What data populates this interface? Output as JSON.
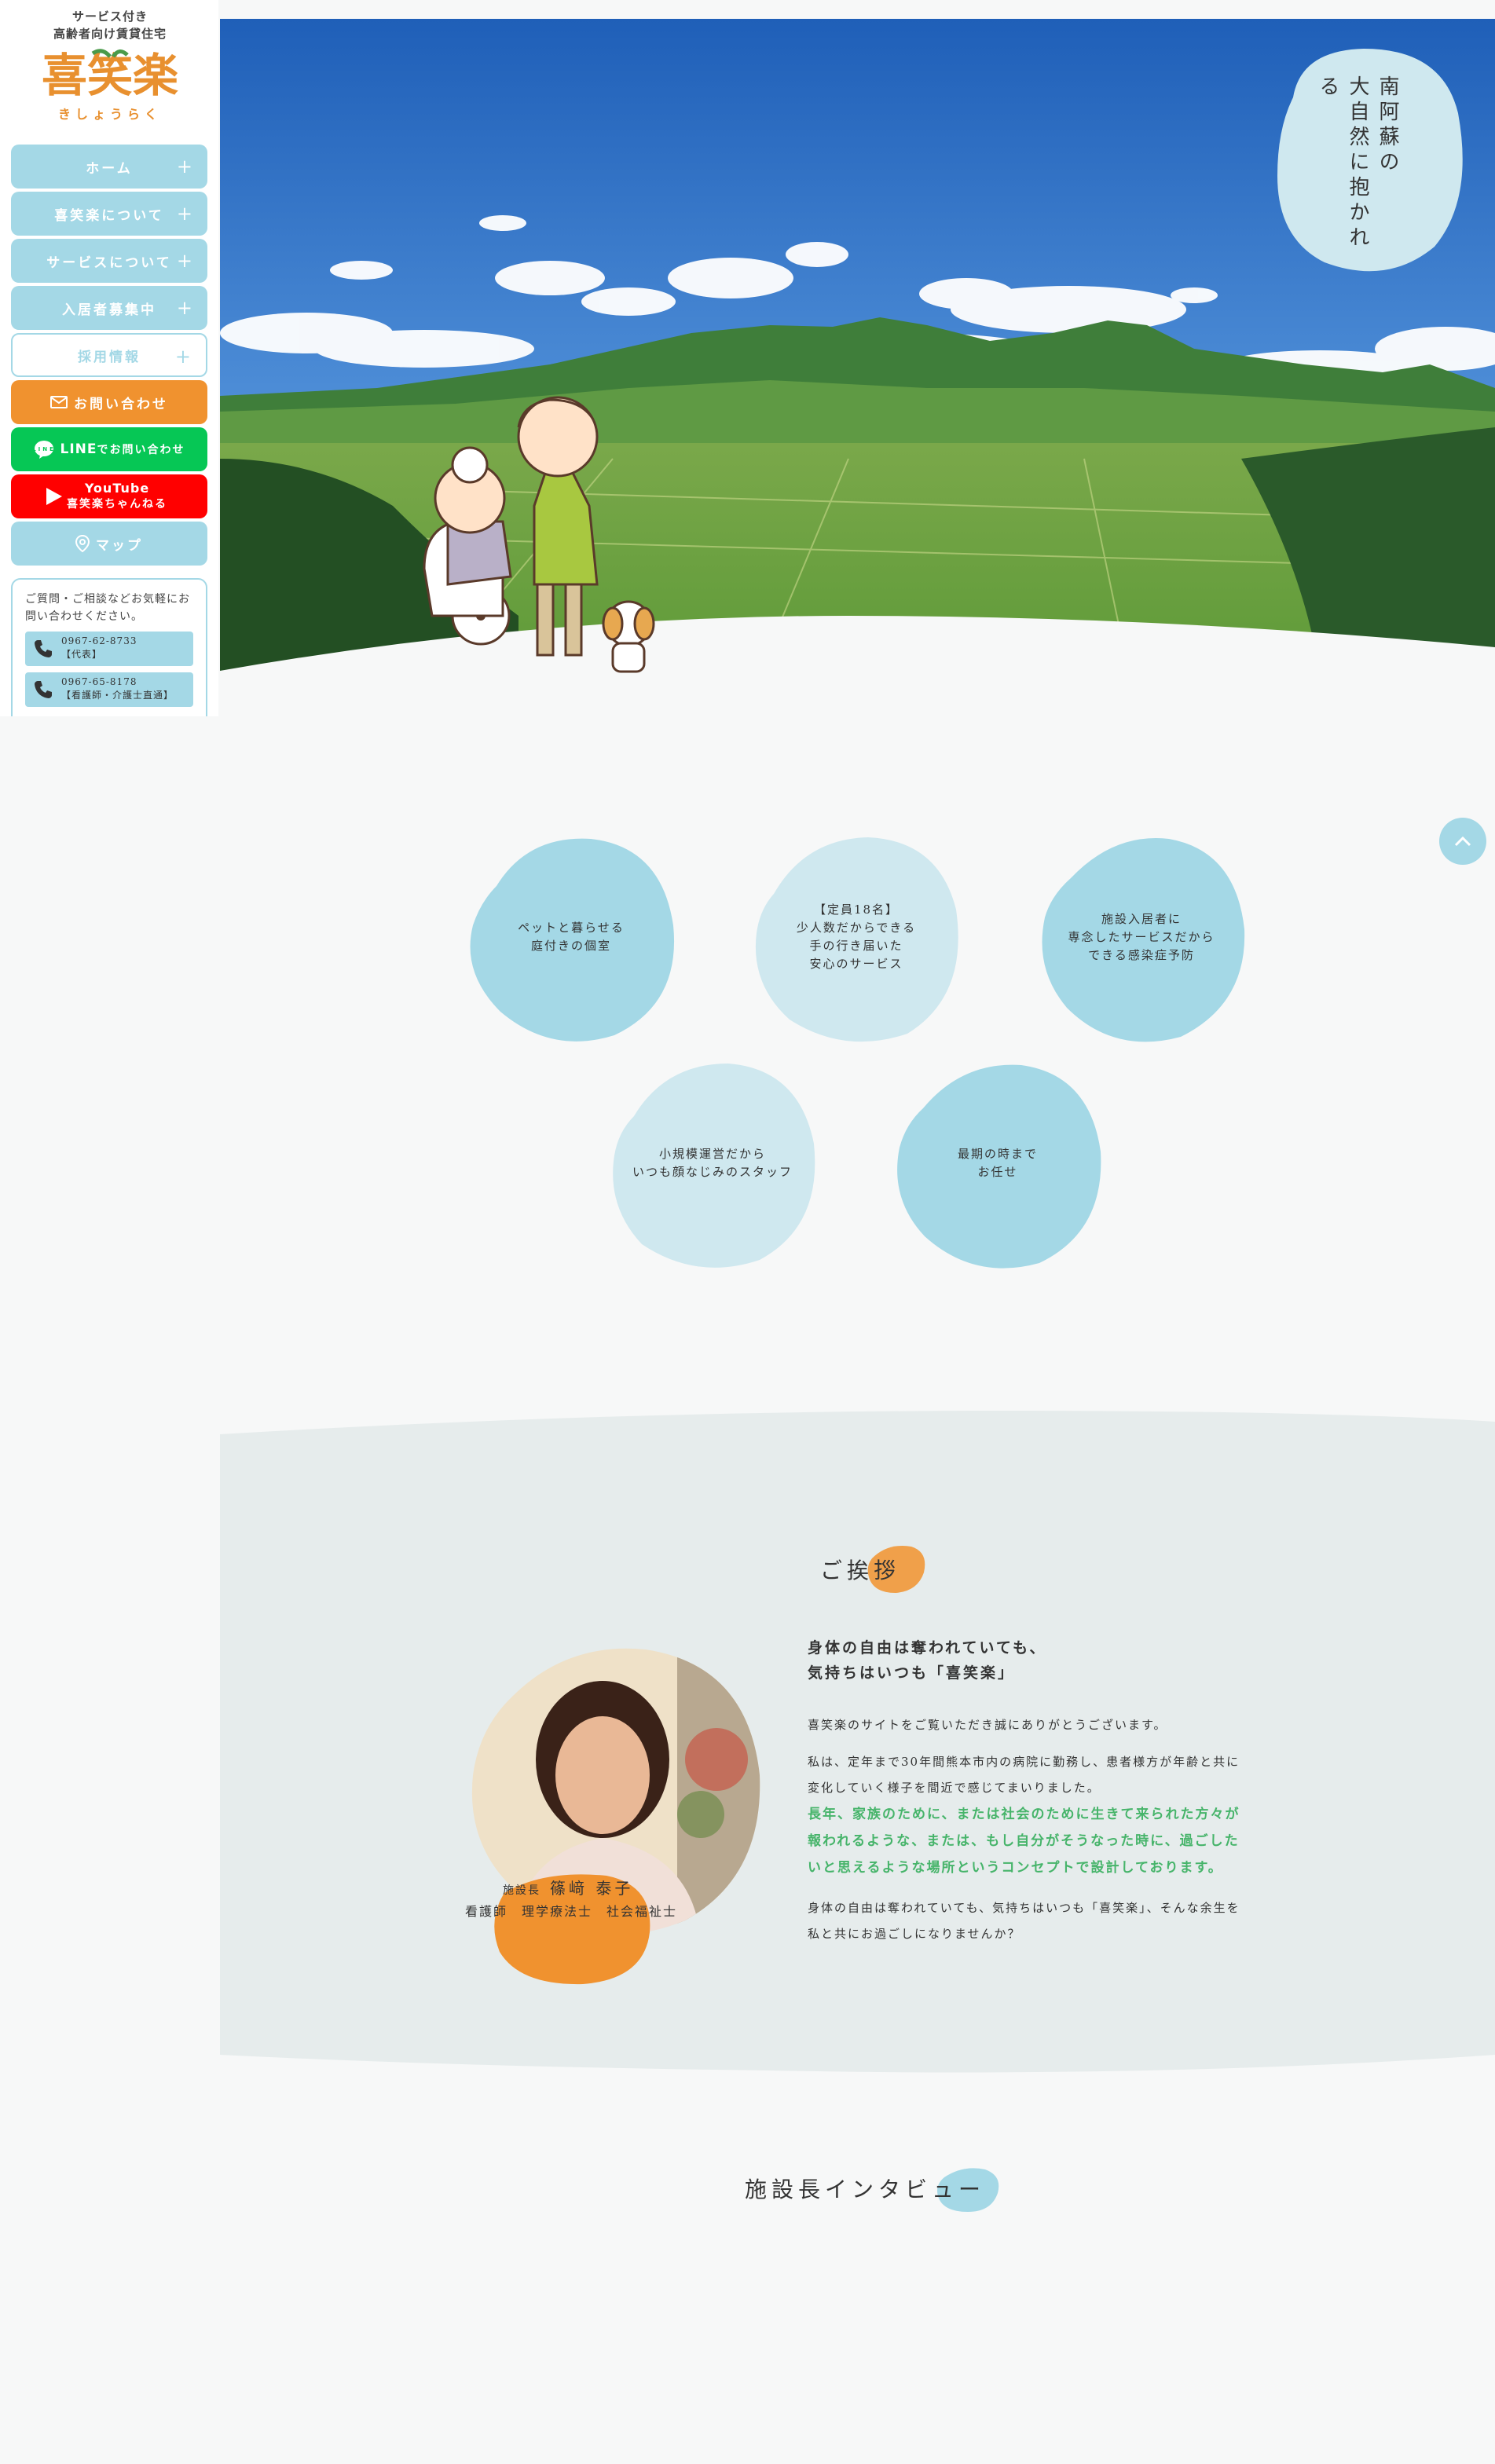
{
  "logo": {
    "line1": "サービス付き",
    "line2": "高齢者向け賃貸住宅",
    "mark": "喜笑楽",
    "kana": "きしょうらく"
  },
  "nav": {
    "home": "ホーム",
    "about": "喜笑楽について",
    "service": "サービスについて",
    "residents": "入居者募集中",
    "recruit": "採用情報",
    "contact": "お問い合わせ",
    "line_bold": "LINE",
    "line_rest": "でお問い合わせ",
    "youtube_title": "YouTube",
    "youtube_channel": "喜笑楽ちゃんねる",
    "map": "マップ",
    "plus": "+"
  },
  "contact_box": {
    "intro": "ご質問・ご相談などお気軽にお問い合わせください。",
    "tel1_number": "0967-62-8733",
    "tel1_label": "【代表】",
    "tel2_number": "0967-65-8178",
    "tel2_label": "【看護師・介護士直通】"
  },
  "hero": {
    "tagline_col1": "南阿蘇の",
    "tagline_col2": "大自然に抱かれる"
  },
  "features": [
    {
      "line1": "ペットと暮らせる",
      "line2": "庭付きの個室"
    },
    {
      "line1": "【定員18名】",
      "line2": "少人数だからできる",
      "line3": "手の行き届いた",
      "line4": "安心のサービス"
    },
    {
      "line1": "施設入居者に",
      "line2": "専念したサービスだから",
      "line3": "できる感染症予防"
    },
    {
      "line1": "小規模運営だから",
      "line2": "いつも顔なじみのスタッフ"
    },
    {
      "line1": "最期の時まで",
      "line2": "お任せ"
    }
  ],
  "greeting": {
    "title": "ご挨拶",
    "name_role": "施設長",
    "name": "篠﨑 泰子",
    "credentials": "看護師　理学療法士　社会福祉士",
    "heading_line1": "身体の自由は奪われていても、",
    "heading_line2": "気持ちはいつも「喜笑楽」",
    "p1": "喜笑楽のサイトをご覧いただき誠にありがとうございます。",
    "p2": "私は、定年まで30年間熊本市内の病院に勤務し、患者様方が年齢と共に変化していく様子を間近で感じてまいりました。",
    "p3": "長年、家族のために、または社会のために生きて来られた方々が報われるような、または、もし自分がそうなった時に、過ごしたいと思えるような場所というコンセプトで設計しております。",
    "p4": "身体の自由は奪われていても、気持ちはいつも「喜笑楽」、そんな余生を私と共にお過ごしになりませんか？"
  },
  "interview": {
    "title": "施設長インタビュー"
  },
  "colors": {
    "accent_blue": "#a4d8e6",
    "light_blue": "#cfe8ef",
    "orange": "#f0922f",
    "line_green": "#06c755",
    "youtube_red": "#ff0000",
    "highlight_green": "#46b46a",
    "section_bg": "#e6ecec"
  }
}
